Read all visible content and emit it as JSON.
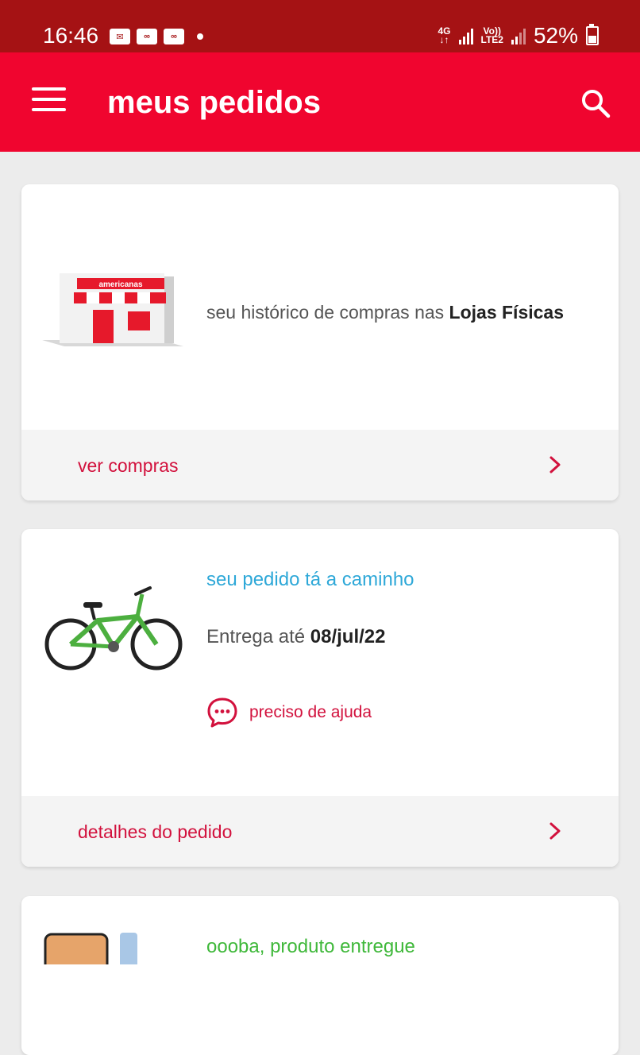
{
  "status_bar": {
    "time": "16:46",
    "network_1": "4G",
    "network_2_top": "Vo))",
    "network_2_bottom": "LTE2",
    "battery": "52%"
  },
  "app_bar": {
    "title": "meus pedidos",
    "menu_icon": "hamburger-menu-icon",
    "search_icon": "search-icon"
  },
  "colors": {
    "status_bar": "#a51214",
    "app_bar": "#f0052f",
    "accent_red": "#d2113d",
    "status_blue": "#2ea8d8",
    "status_green": "#3fb83a"
  },
  "cards": {
    "stores": {
      "image_sign": "americanas",
      "text_prefix": "seu histórico de compras nas ",
      "text_bold": "Lojas Físicas",
      "footer_label": "ver compras"
    },
    "order1": {
      "status": "seu pedido tá a caminho",
      "delivery_prefix": "Entrega até ",
      "delivery_date": "08/jul/22",
      "help_label": "preciso de ajuda",
      "footer_label": "detalhes do pedido"
    },
    "order2": {
      "status": "oooba, produto entregue"
    }
  }
}
